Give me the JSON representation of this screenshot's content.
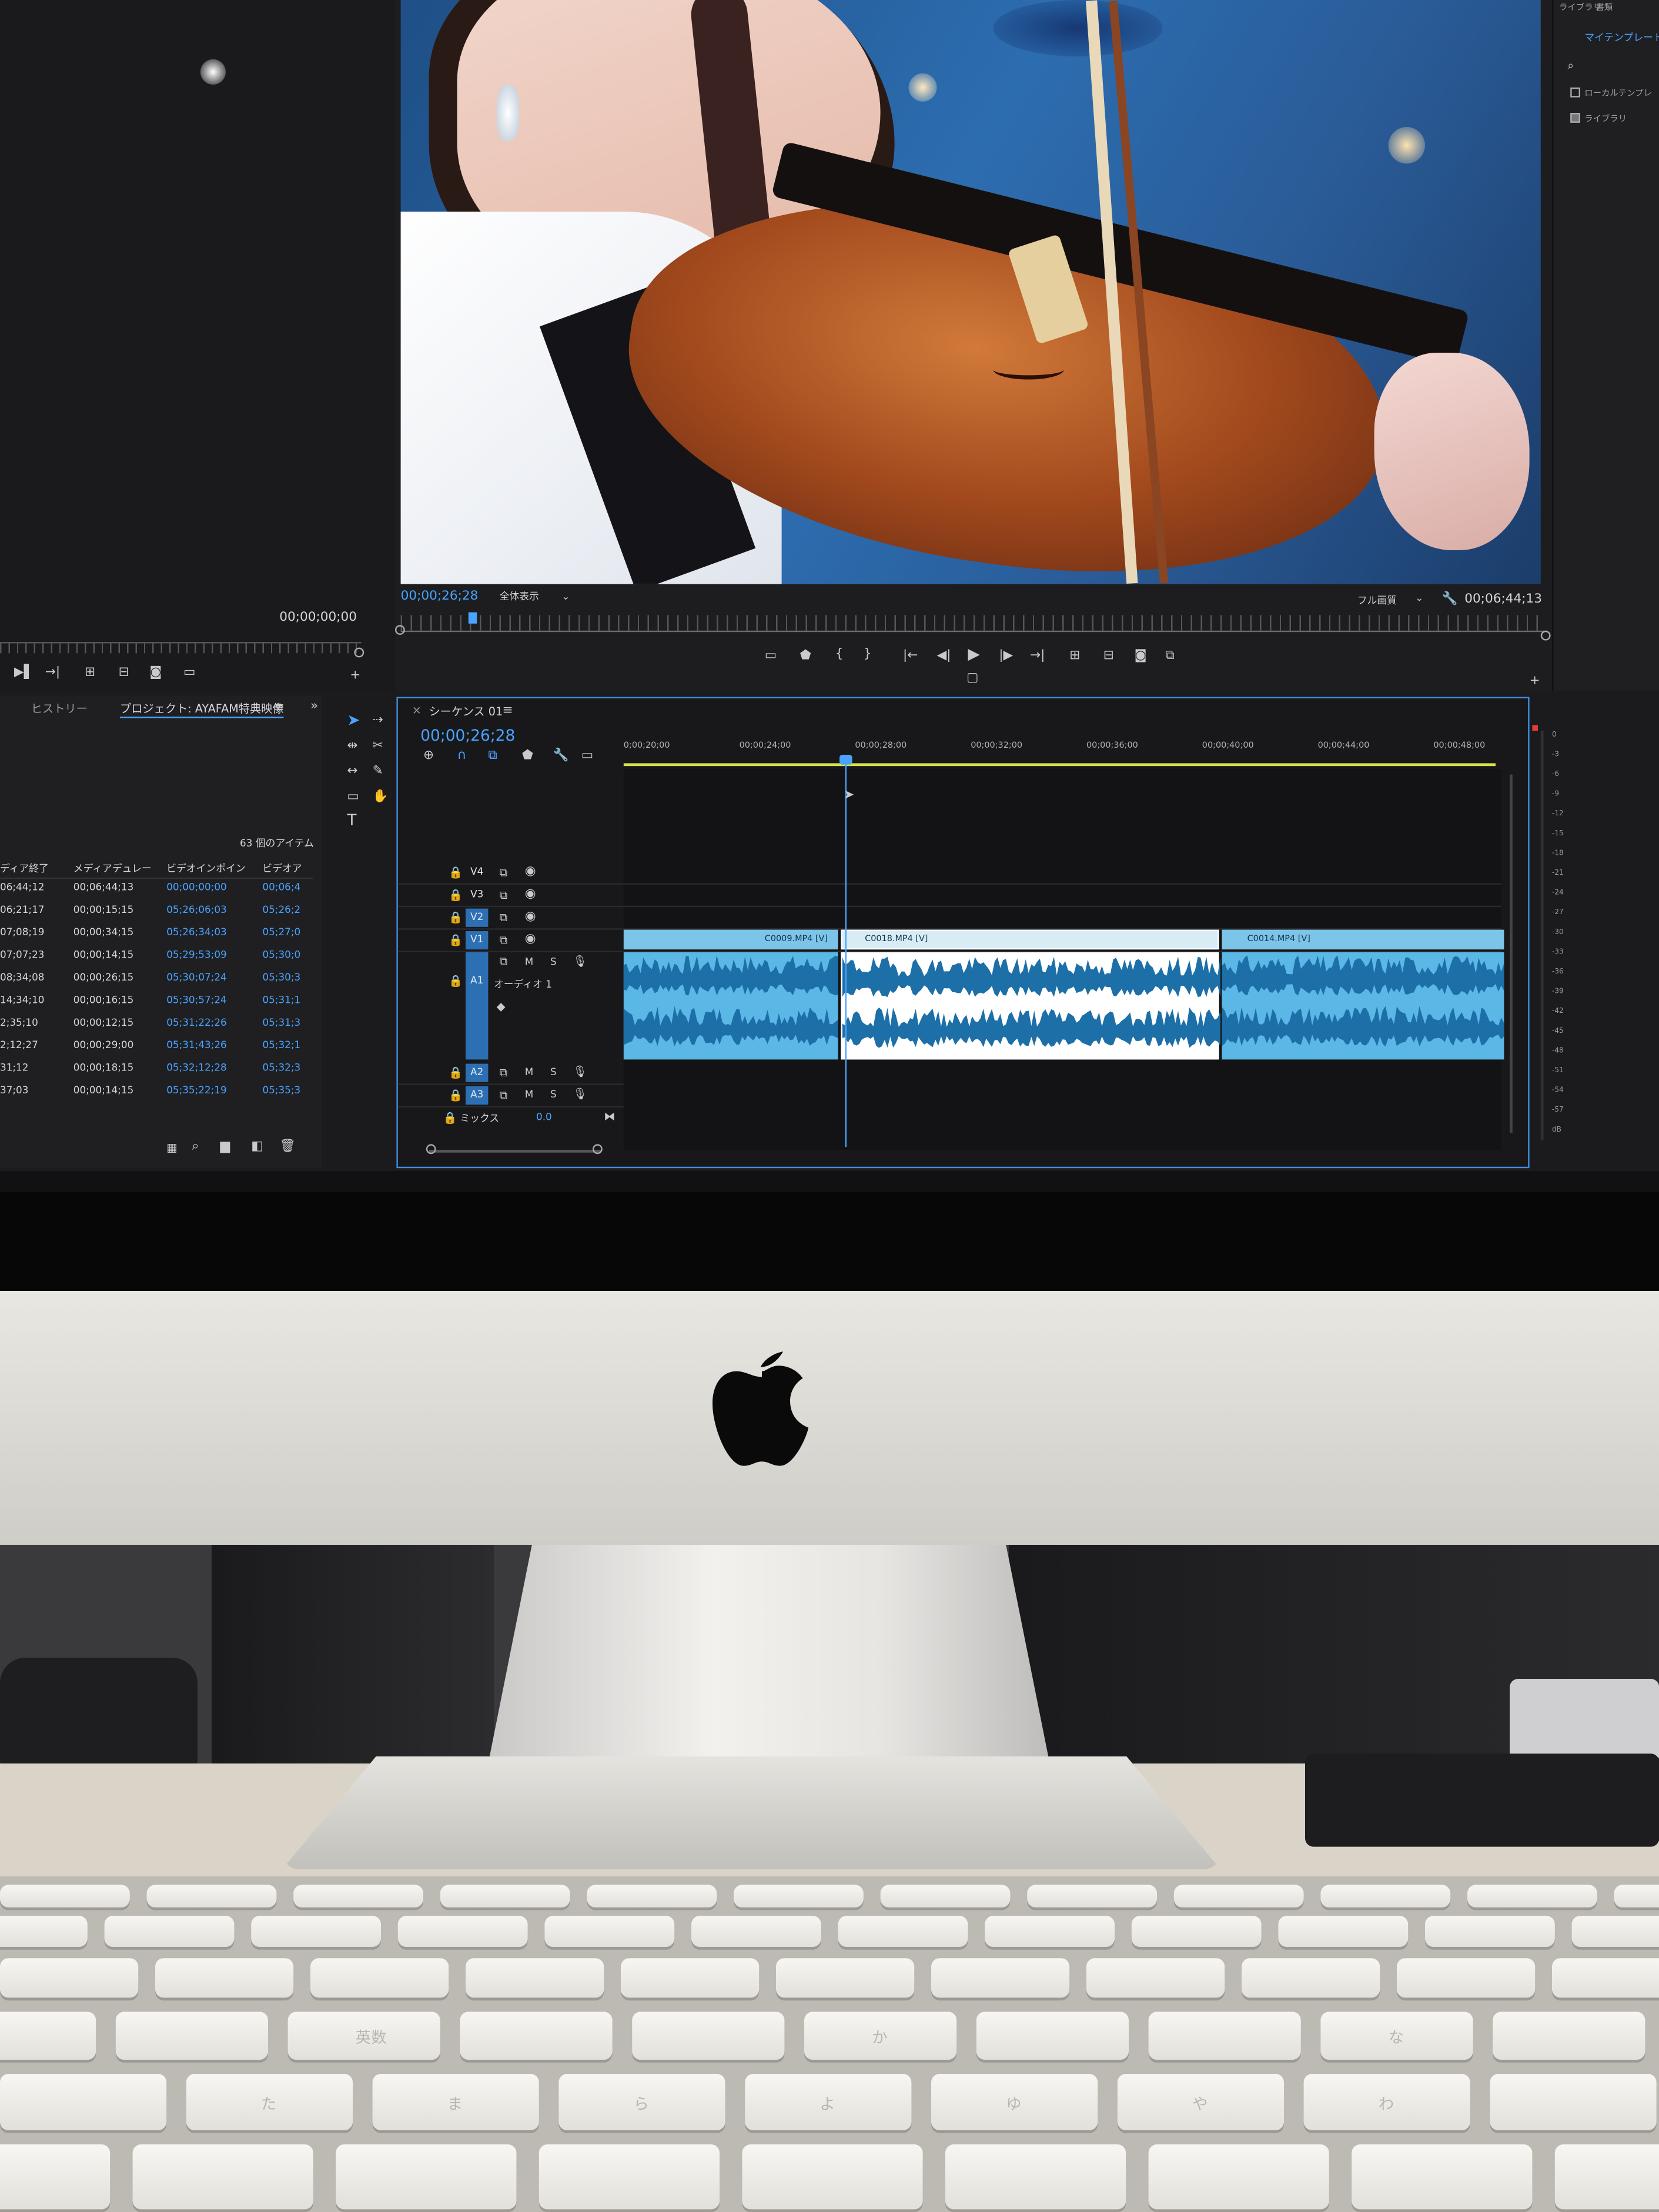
{
  "colors": {
    "accent": "#4aa3ff",
    "audio_clip": "#5ab7e6",
    "video_clip": "#7cc4e8",
    "playhead": "#4aa3ff",
    "work_area": "#d7e24a"
  },
  "program_monitor": {
    "timecode_current": "00;00;26;28",
    "zoom_label": "全体表示",
    "quality_label": "フル画質",
    "timecode_total": "00;06;44;13"
  },
  "source_monitor": {
    "timecode": "00;00;00;00"
  },
  "right_panel": {
    "top_tabs": [
      "ライブラリ",
      "書類"
    ],
    "search_label": "マイテンプレート",
    "checkboxes": [
      "ローカルテンプレ",
      "ライブラリ"
    ]
  },
  "project_panel": {
    "tabs": [
      "ヒストリー",
      "プロジェクト: AYAFAM特典映像"
    ],
    "item_count": "63 個のアイテム",
    "columns": [
      "ディア終了",
      "メディアデュレー",
      "ビデオインポイン",
      "ビデオア"
    ],
    "rows": [
      [
        "06;44;12",
        "00;06;44;13",
        "00;00;00;00",
        "00;06;4"
      ],
      [
        "06;21;17",
        "00;00;15;15",
        "05;26;06;03",
        "05;26;2"
      ],
      [
        "07;08;19",
        "00;00;34;15",
        "05;26;34;03",
        "05;27;0"
      ],
      [
        "07;07;23",
        "00;00;14;15",
        "05;29;53;09",
        "05;30;0"
      ],
      [
        "08;34;08",
        "00;00;26;15",
        "05;30;07;24",
        "05;30;3"
      ],
      [
        "14;34;10",
        "00;00;16;15",
        "05;30;57;24",
        "05;31;1"
      ],
      [
        "2;35;10",
        "00;00;12;15",
        "05;31;22;26",
        "05;31;3"
      ],
      [
        "2;12;27",
        "00;00;29;00",
        "05;31;43;26",
        "05;32;1"
      ],
      [
        "31;12",
        "00;00;18;15",
        "05;32;12;28",
        "05;32;3"
      ],
      [
        "37;03",
        "00;00;14;15",
        "05;35;22;19",
        "05;35;3"
      ]
    ]
  },
  "sequence": {
    "close": "×",
    "tab_label": "シーケンス 01",
    "timecode": "00;00;26;28",
    "ruler_ticks": [
      "0;00;20;00",
      "00;00;24;00",
      "00;00;28;00",
      "00;00;32;00",
      "00;00;36;00",
      "00;00;40;00",
      "00;00;44;00",
      "00;00;48;00"
    ],
    "tracks_video": [
      "V4",
      "V3",
      "V2",
      "V1"
    ],
    "tracks_audio": [
      "A1",
      "A2",
      "A3"
    ],
    "audio_track_name": "オーディオ 1",
    "mix_label": "ミックス",
    "mix_value": "0.0",
    "track_buttons": [
      "M",
      "S"
    ],
    "clips_video": [
      "C0009.MP4 [V]",
      "C0018.MP4 [V]",
      "C0014.MP4 [V]"
    ]
  },
  "meter_scale": [
    "0",
    "-3",
    "-6",
    "-9",
    "-12",
    "-15",
    "-18",
    "-21",
    "-24",
    "-27",
    "-30",
    "-33",
    "-36",
    "-39",
    "-42",
    "-45",
    "-48",
    "-51",
    "-54",
    "-57",
    "dB"
  ],
  "keyboard_legends": [
    "英数",
    "か",
    "な",
    "た",
    "ま",
    "ら",
    "よ",
    "ゆ",
    "や",
    "わ"
  ]
}
